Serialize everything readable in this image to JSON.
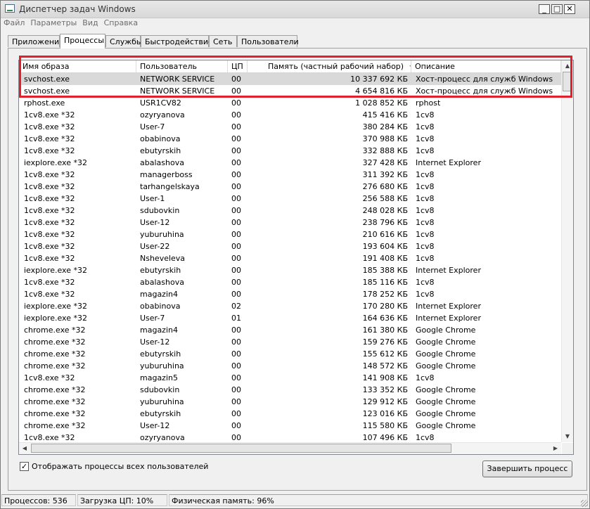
{
  "window": {
    "title": "Диспетчер задач Windows"
  },
  "menu": [
    "Файл",
    "Параметры",
    "Вид",
    "Справка"
  ],
  "tabs": [
    {
      "label": "Приложения",
      "active": false
    },
    {
      "label": "Процессы",
      "active": true
    },
    {
      "label": "Службы",
      "active": false
    },
    {
      "label": "Быстродействие",
      "active": false
    },
    {
      "label": "Сеть",
      "active": false
    },
    {
      "label": "Пользователи",
      "active": false
    }
  ],
  "columns": {
    "name": "Имя образа",
    "user": "Пользователь",
    "cpu": "ЦП",
    "memory": "Память (частный рабочий набор)",
    "description": "Описание"
  },
  "processes": [
    {
      "name": "svchost.exe",
      "user": "NETWORK SERVICE",
      "cpu": "00",
      "memory": "10 337 692 КБ",
      "description": "Хост-процесс для служб Windows",
      "selected": true
    },
    {
      "name": "svchost.exe",
      "user": "NETWORK SERVICE",
      "cpu": "00",
      "memory": "4 654 816 КБ",
      "description": "Хост-процесс для служб Windows"
    },
    {
      "name": "rphost.exe",
      "user": "USR1CV82",
      "cpu": "00",
      "memory": "1 028 852 КБ",
      "description": "rphost"
    },
    {
      "name": "1cv8.exe *32",
      "user": "ozyryanova",
      "cpu": "00",
      "memory": "415 416 КБ",
      "description": "1cv8"
    },
    {
      "name": "1cv8.exe *32",
      "user": "User-7",
      "cpu": "00",
      "memory": "380 284 КБ",
      "description": "1cv8"
    },
    {
      "name": "1cv8.exe *32",
      "user": "obabinova",
      "cpu": "00",
      "memory": "370 988 КБ",
      "description": "1cv8"
    },
    {
      "name": "1cv8.exe *32",
      "user": "ebutyrskih",
      "cpu": "00",
      "memory": "332 888 КБ",
      "description": "1cv8"
    },
    {
      "name": "iexplore.exe *32",
      "user": "abalashova",
      "cpu": "00",
      "memory": "327 428 КБ",
      "description": "Internet Explorer"
    },
    {
      "name": "1cv8.exe *32",
      "user": "managerboss",
      "cpu": "00",
      "memory": "311 392 КБ",
      "description": "1cv8"
    },
    {
      "name": "1cv8.exe *32",
      "user": "tarhangelskaya",
      "cpu": "00",
      "memory": "276 680 КБ",
      "description": "1cv8"
    },
    {
      "name": "1cv8.exe *32",
      "user": "User-1",
      "cpu": "00",
      "memory": "256 588 КБ",
      "description": "1cv8"
    },
    {
      "name": "1cv8.exe *32",
      "user": "sdubovkin",
      "cpu": "00",
      "memory": "248 028 КБ",
      "description": "1cv8"
    },
    {
      "name": "1cv8.exe *32",
      "user": "User-12",
      "cpu": "00",
      "memory": "238 796 КБ",
      "description": "1cv8"
    },
    {
      "name": "1cv8.exe *32",
      "user": "yuburuhina",
      "cpu": "00",
      "memory": "210 616 КБ",
      "description": "1cv8"
    },
    {
      "name": "1cv8.exe *32",
      "user": "User-22",
      "cpu": "00",
      "memory": "193 604 КБ",
      "description": "1cv8"
    },
    {
      "name": "1cv8.exe *32",
      "user": "Nsheveleva",
      "cpu": "00",
      "memory": "191 408 КБ",
      "description": "1cv8"
    },
    {
      "name": "iexplore.exe *32",
      "user": "ebutyrskih",
      "cpu": "00",
      "memory": "185 388 КБ",
      "description": "Internet Explorer"
    },
    {
      "name": "1cv8.exe *32",
      "user": "abalashova",
      "cpu": "00",
      "memory": "185 116 КБ",
      "description": "1cv8"
    },
    {
      "name": "1cv8.exe *32",
      "user": "magazin4",
      "cpu": "00",
      "memory": "178 252 КБ",
      "description": "1cv8"
    },
    {
      "name": "iexplore.exe *32",
      "user": "obabinova",
      "cpu": "02",
      "memory": "170 280 КБ",
      "description": "Internet Explorer"
    },
    {
      "name": "iexplore.exe *32",
      "user": "User-7",
      "cpu": "01",
      "memory": "164 636 КБ",
      "description": "Internet Explorer"
    },
    {
      "name": "chrome.exe *32",
      "user": "magazin4",
      "cpu": "00",
      "memory": "161 380 КБ",
      "description": "Google Chrome"
    },
    {
      "name": "chrome.exe *32",
      "user": "User-12",
      "cpu": "00",
      "memory": "159 276 КБ",
      "description": "Google Chrome"
    },
    {
      "name": "chrome.exe *32",
      "user": "ebutyrskih",
      "cpu": "00",
      "memory": "155 612 КБ",
      "description": "Google Chrome"
    },
    {
      "name": "chrome.exe *32",
      "user": "yuburuhina",
      "cpu": "00",
      "memory": "148 572 КБ",
      "description": "Google Chrome"
    },
    {
      "name": "1cv8.exe *32",
      "user": "magazin5",
      "cpu": "00",
      "memory": "141 908 КБ",
      "description": "1cv8"
    },
    {
      "name": "chrome.exe *32",
      "user": "sdubovkin",
      "cpu": "00",
      "memory": "133 352 КБ",
      "description": "Google Chrome"
    },
    {
      "name": "chrome.exe *32",
      "user": "yuburuhina",
      "cpu": "00",
      "memory": "129 912 КБ",
      "description": "Google Chrome"
    },
    {
      "name": "chrome.exe *32",
      "user": "ebutyrskih",
      "cpu": "00",
      "memory": "123 016 КБ",
      "description": "Google Chrome"
    },
    {
      "name": "chrome.exe *32",
      "user": "User-12",
      "cpu": "00",
      "memory": "115 580 КБ",
      "description": "Google Chrome"
    },
    {
      "name": "1cv8.exe *32",
      "user": "ozyryanova",
      "cpu": "00",
      "memory": "107 496 КБ",
      "description": "1cv8"
    }
  ],
  "show_all_users": {
    "label": "Отображать процессы всех пользователей",
    "checked": true
  },
  "end_process_button": "Завершить процесс",
  "status": {
    "processes": "Процессов: 536",
    "cpu": "Загрузка ЦП: 10%",
    "memory": "Физическая память: 96%"
  },
  "colors": {
    "highlight_box": "#e0202a",
    "selected_row": "#d9d9d9"
  }
}
